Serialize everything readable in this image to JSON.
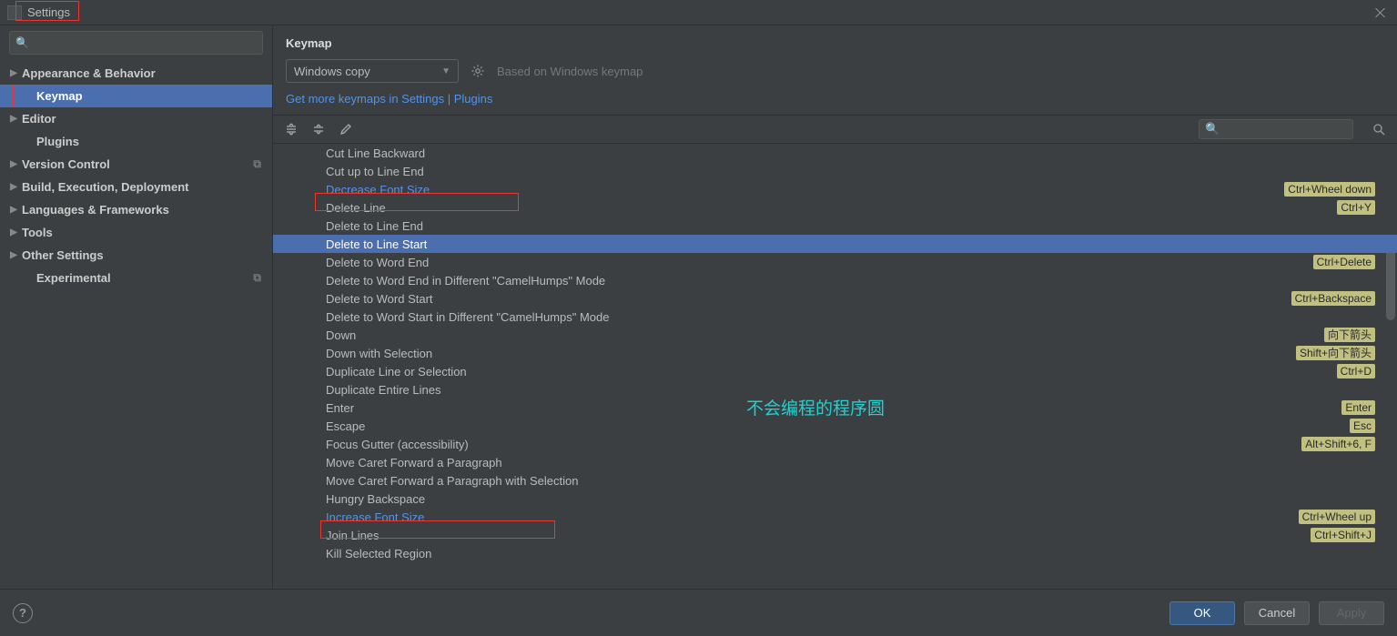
{
  "window": {
    "title": "Settings"
  },
  "sidebar": {
    "items": [
      {
        "label": "Appearance & Behavior",
        "arrow": "▶",
        "leaf": false,
        "selected": false,
        "badge": ""
      },
      {
        "label": "Keymap",
        "arrow": "",
        "leaf": true,
        "selected": true,
        "badge": ""
      },
      {
        "label": "Editor",
        "arrow": "▶",
        "leaf": false,
        "selected": false,
        "badge": ""
      },
      {
        "label": "Plugins",
        "arrow": "",
        "leaf": true,
        "selected": false,
        "badge": ""
      },
      {
        "label": "Version Control",
        "arrow": "▶",
        "leaf": false,
        "selected": false,
        "badge": "⧉"
      },
      {
        "label": "Build, Execution, Deployment",
        "arrow": "▶",
        "leaf": false,
        "selected": false,
        "badge": ""
      },
      {
        "label": "Languages & Frameworks",
        "arrow": "▶",
        "leaf": false,
        "selected": false,
        "badge": ""
      },
      {
        "label": "Tools",
        "arrow": "▶",
        "leaf": false,
        "selected": false,
        "badge": ""
      },
      {
        "label": "Other Settings",
        "arrow": "▶",
        "leaf": false,
        "selected": false,
        "badge": ""
      },
      {
        "label": "Experimental",
        "arrow": "",
        "leaf": true,
        "selected": false,
        "badge": "⧉"
      }
    ]
  },
  "content": {
    "title": "Keymap",
    "scheme": "Windows copy",
    "based_on": "Based on Windows keymap",
    "link_text": "Get more keymaps in Settings | Plugins"
  },
  "actions": [
    {
      "label": "Cut Line Backward",
      "shortcut": "",
      "link": false,
      "selected": false,
      "redbox": false
    },
    {
      "label": "Cut up to Line End",
      "shortcut": "",
      "link": false,
      "selected": false,
      "redbox": false
    },
    {
      "label": "Decrease Font Size",
      "shortcut": "Ctrl+Wheel down",
      "link": true,
      "selected": false,
      "redbox": true
    },
    {
      "label": "Delete Line",
      "shortcut": "Ctrl+Y",
      "link": false,
      "selected": false,
      "redbox": false
    },
    {
      "label": "Delete to Line End",
      "shortcut": "",
      "link": false,
      "selected": false,
      "redbox": false
    },
    {
      "label": "Delete to Line Start",
      "shortcut": "",
      "link": false,
      "selected": true,
      "redbox": false
    },
    {
      "label": "Delete to Word End",
      "shortcut": "Ctrl+Delete",
      "link": false,
      "selected": false,
      "redbox": false
    },
    {
      "label": "Delete to Word End in Different \"CamelHumps\" Mode",
      "shortcut": "",
      "link": false,
      "selected": false,
      "redbox": false
    },
    {
      "label": "Delete to Word Start",
      "shortcut": "Ctrl+Backspace",
      "link": false,
      "selected": false,
      "redbox": false
    },
    {
      "label": "Delete to Word Start in Different \"CamelHumps\" Mode",
      "shortcut": "",
      "link": false,
      "selected": false,
      "redbox": false
    },
    {
      "label": "Down",
      "shortcut": "向下箭头",
      "link": false,
      "selected": false,
      "redbox": false
    },
    {
      "label": "Down with Selection",
      "shortcut": "Shift+向下箭头",
      "link": false,
      "selected": false,
      "redbox": false
    },
    {
      "label": "Duplicate Line or Selection",
      "shortcut": "Ctrl+D",
      "link": false,
      "selected": false,
      "redbox": false
    },
    {
      "label": "Duplicate Entire Lines",
      "shortcut": "",
      "link": false,
      "selected": false,
      "redbox": false
    },
    {
      "label": "Enter",
      "shortcut": "Enter",
      "link": false,
      "selected": false,
      "redbox": false
    },
    {
      "label": "Escape",
      "shortcut": "Esc",
      "link": false,
      "selected": false,
      "redbox": false
    },
    {
      "label": "Focus Gutter (accessibility)",
      "shortcut": "Alt+Shift+6, F",
      "link": false,
      "selected": false,
      "redbox": false
    },
    {
      "label": "Move Caret Forward a Paragraph",
      "shortcut": "",
      "link": false,
      "selected": false,
      "redbox": false
    },
    {
      "label": "Move Caret Forward a Paragraph with Selection",
      "shortcut": "",
      "link": false,
      "selected": false,
      "redbox": false
    },
    {
      "label": "Hungry Backspace",
      "shortcut": "",
      "link": false,
      "selected": false,
      "redbox": false
    },
    {
      "label": "Increase Font Size",
      "shortcut": "Ctrl+Wheel up",
      "link": true,
      "selected": false,
      "redbox": true
    },
    {
      "label": "Join Lines",
      "shortcut": "Ctrl+Shift+J",
      "link": false,
      "selected": false,
      "redbox": false
    },
    {
      "label": "Kill Selected Region",
      "shortcut": "",
      "link": false,
      "selected": false,
      "redbox": false
    }
  ],
  "footer": {
    "ok": "OK",
    "cancel": "Cancel",
    "apply": "Apply"
  },
  "watermark": "不会编程的程序圆"
}
